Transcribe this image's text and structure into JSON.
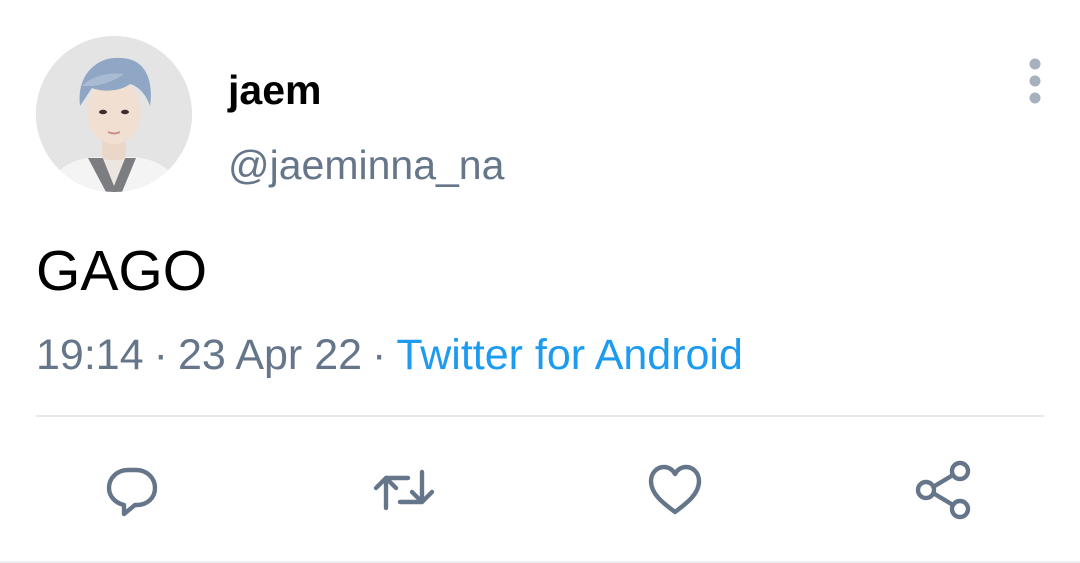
{
  "user": {
    "display_name": "jaem",
    "handle": "@jaeminna_na"
  },
  "tweet": {
    "text": "GAGO",
    "time": "19:14",
    "date": "23 Apr 22",
    "separator": "·",
    "source": "Twitter for Android"
  },
  "actions": {
    "reply_icon": "reply-icon",
    "retweet_icon": "retweet-icon",
    "like_icon": "heart-icon",
    "share_icon": "share-icon",
    "more_icon": "more-vertical-icon"
  },
  "colors": {
    "text_primary": "#000000",
    "text_secondary": "#66768a",
    "link": "#1d9bf0",
    "icon": "#66768a",
    "divider": "#e6e8eb"
  }
}
